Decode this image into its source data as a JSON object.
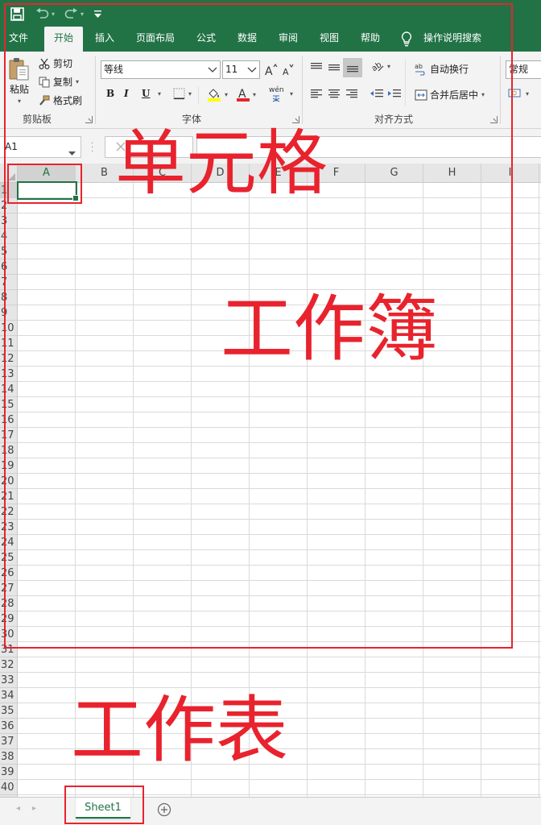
{
  "quick_access": {
    "save_icon": "save-icon",
    "undo_icon": "undo-icon",
    "redo_icon": "redo-icon",
    "customize_icon": "customize-qat-icon"
  },
  "ribbon_tabs": [
    {
      "label": "文件",
      "active": false
    },
    {
      "label": "开始",
      "active": true
    },
    {
      "label": "插入",
      "active": false
    },
    {
      "label": "页面布局",
      "active": false
    },
    {
      "label": "公式",
      "active": false
    },
    {
      "label": "数据",
      "active": false
    },
    {
      "label": "审阅",
      "active": false
    },
    {
      "label": "视图",
      "active": false
    },
    {
      "label": "帮助",
      "active": false
    }
  ],
  "tell_me": "操作说明搜索",
  "clipboard": {
    "paste": "粘贴",
    "cut": "剪切",
    "copy": "复制",
    "format_painter": "格式刷",
    "group_label": "剪贴板"
  },
  "font": {
    "name": "等线",
    "size": "11",
    "bold": "B",
    "italic": "I",
    "underline": "U",
    "phonetic": "wén",
    "group_label": "字体",
    "font_color": "#e8232d",
    "highlight_color": "#ffff00"
  },
  "alignment": {
    "wrap_text": "自动换行",
    "merge_center": "合并后居中",
    "group_label": "对齐方式"
  },
  "number": {
    "format": "常规"
  },
  "formula_bar": {
    "name_box": "A1",
    "formula": ""
  },
  "grid": {
    "columns": [
      "A",
      "B",
      "C",
      "D",
      "E",
      "F",
      "G",
      "H",
      "I"
    ],
    "rows": [
      "1",
      "2",
      "3",
      "4",
      "5",
      "6",
      "7",
      "8",
      "9",
      "10",
      "11",
      "12",
      "13",
      "14",
      "15",
      "16",
      "17",
      "18",
      "19",
      "20",
      "21",
      "22",
      "23",
      "24",
      "25",
      "26",
      "27",
      "28",
      "29",
      "30",
      "31",
      "32",
      "33",
      "34",
      "35",
      "36",
      "37",
      "38",
      "39",
      "40"
    ],
    "selected_column": "A",
    "selected_row": "1"
  },
  "sheets": [
    {
      "label": "Sheet1",
      "active": true
    }
  ],
  "annotations": {
    "cell": "单元格",
    "workbook": "工作簿",
    "worksheet": "工作表",
    "color": "#e8232d"
  },
  "theme": {
    "accent": "#217346",
    "ribbon_bg": "#f3f3f3"
  }
}
